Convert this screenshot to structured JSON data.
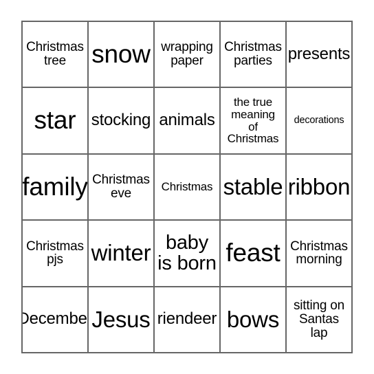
{
  "card": {
    "name": "christmas-bingo-card",
    "grid": {
      "columns": 5,
      "rows": 5,
      "border_color": "#666666",
      "background": "#ffffff",
      "text_color": "#000000"
    },
    "cells": [
      [
        {
          "text": "Christmas\ntree",
          "size": "s"
        },
        {
          "text": "snow",
          "size": "xxl"
        },
        {
          "text": "wrapping\npaper",
          "size": "s"
        },
        {
          "text": "Christmas\nparties",
          "size": "s"
        },
        {
          "text": "presents",
          "size": "m"
        }
      ],
      [
        {
          "text": "star",
          "size": "xxl"
        },
        {
          "text": "stocking",
          "size": "m"
        },
        {
          "text": "animals",
          "size": "m"
        },
        {
          "text": "the true\nmeaning\nof\nChristmas",
          "size": "xs"
        },
        {
          "text": "decorations",
          "size": "xxs"
        }
      ],
      [
        {
          "text": "family",
          "size": "xxl"
        },
        {
          "text": "Christmas\neve",
          "size": "s"
        },
        {
          "text": "Christmas",
          "size": "xs"
        },
        {
          "text": "stable",
          "size": "xl"
        },
        {
          "text": "ribbon",
          "size": "xl"
        }
      ],
      [
        {
          "text": "Christmas\npjs",
          "size": "s"
        },
        {
          "text": "winter",
          "size": "xl"
        },
        {
          "text": "baby\nis born",
          "size": "l"
        },
        {
          "text": "feast",
          "size": "xxl"
        },
        {
          "text": "Christmas\nmorning",
          "size": "s"
        }
      ],
      [
        {
          "text": "December",
          "size": "m"
        },
        {
          "text": "Jesus",
          "size": "xl"
        },
        {
          "text": "riendeer",
          "size": "m"
        },
        {
          "text": "bows",
          "size": "xl"
        },
        {
          "text": "sitting on\nSantas\nlap",
          "size": "s"
        }
      ]
    ]
  }
}
